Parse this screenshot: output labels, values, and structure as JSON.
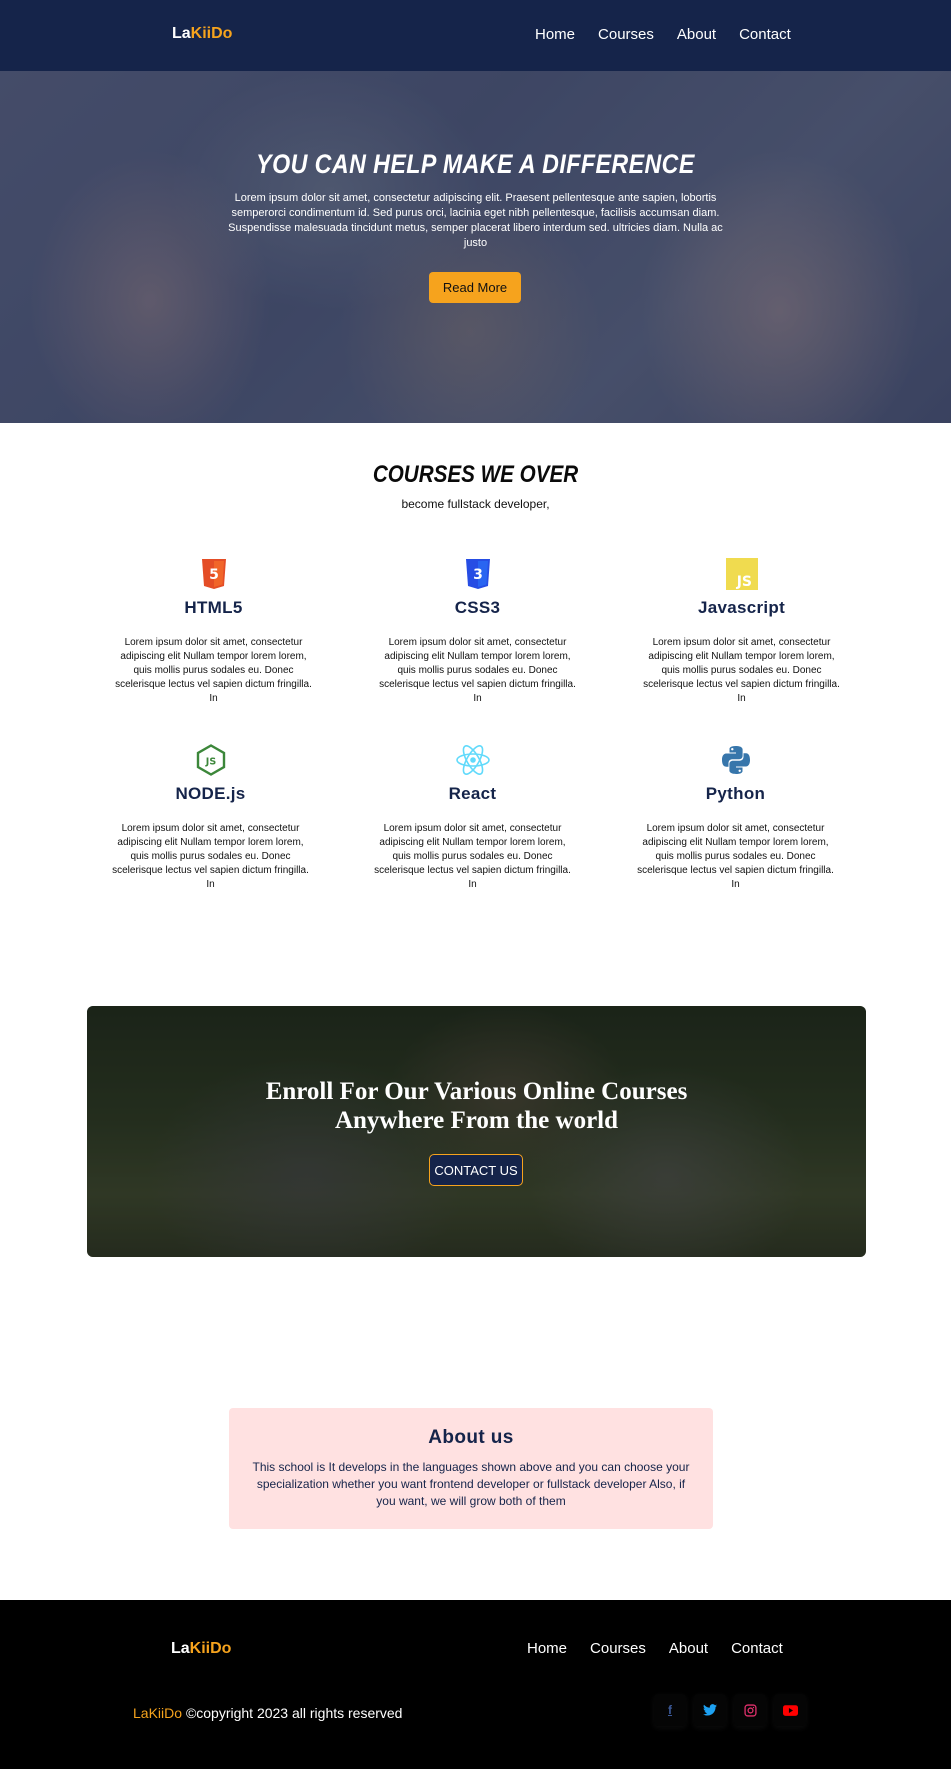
{
  "brand": {
    "part1": "La",
    "part2": "KiiDo"
  },
  "nav": {
    "items": [
      "Home",
      "Courses",
      "About",
      "Contact"
    ]
  },
  "hero": {
    "title": "YOU CAN HELP MAKE A DIFFERENCE",
    "text": "Lorem ipsum dolor sit amet, consectetur adipiscing elit. Praesent pellentesque ante sapien, lobortis semperorci condimentum id. Sed purus orci, lacinia eget nibh pellentesque, facilisis accumsan diam. Suspendisse malesuada tincidunt metus, semper placerat libero interdum sed. ultricies diam. Nulla ac justo",
    "button": "Read More"
  },
  "courses": {
    "title": "COURSES WE OVER",
    "subtitle": "become fullstack developer,",
    "items": [
      {
        "name": "HTML5",
        "icon": "html5-icon",
        "color": "#e44d26",
        "desc": "Lorem ipsum dolor sit amet, consectetur adipiscing elit Nullam tempor lorem lorem, quis mollis purus sodales eu. Donec scelerisque lectus vel sapien dictum fringilla. In"
      },
      {
        "name": "CSS3",
        "icon": "css3-icon",
        "color": "#264de4",
        "desc": "Lorem ipsum dolor sit amet, consectetur adipiscing elit Nullam tempor lorem lorem, quis mollis purus sodales eu. Donec scelerisque lectus vel sapien dictum fringilla. In"
      },
      {
        "name": "Javascript",
        "icon": "javascript-icon",
        "color": "#f0db4f",
        "desc": "Lorem ipsum dolor sit amet, consectetur adipiscing elit Nullam tempor lorem lorem, quis mollis purus sodales eu. Donec scelerisque lectus vel sapien dictum fringilla. In"
      },
      {
        "name": "NODE.js",
        "icon": "nodejs-icon",
        "color": "#3c873a",
        "desc": "Lorem ipsum dolor sit amet, consectetur adipiscing elit Nullam tempor lorem lorem, quis mollis purus sodales eu. Donec scelerisque lectus vel sapien dictum fringilla. In"
      },
      {
        "name": "React",
        "icon": "react-icon",
        "color": "#61dafb",
        "desc": "Lorem ipsum dolor sit amet, consectetur adipiscing elit Nullam tempor lorem lorem, quis mollis purus sodales eu. Donec scelerisque lectus vel sapien dictum fringilla. In"
      },
      {
        "name": "Python",
        "icon": "python-icon",
        "color": "#3776ab",
        "desc": "Lorem ipsum dolor sit amet, consectetur adipiscing elit Nullam tempor lorem lorem, quis mollis purus sodales eu. Donec scelerisque lectus vel sapien dictum fringilla. In"
      }
    ]
  },
  "enroll": {
    "line1": "Enroll For Our Various Online Courses",
    "line2": "Anywhere From the world",
    "button": "CONTACT US"
  },
  "about": {
    "title": "About us",
    "text": "This school is It develops in the languages shown above and you can choose your specialization whether you want frontend developer or fullstack developer Also, if you want, we will grow both of them"
  },
  "footer": {
    "copyright": "©copyright 2023 all rights reserved",
    "socials": [
      {
        "icon": "facebook-icon",
        "glyph": "f",
        "color": "#3b5998"
      },
      {
        "icon": "twitter-icon",
        "glyph": "t",
        "color": "#1da1f2"
      },
      {
        "icon": "instagram-icon",
        "glyph": "◎",
        "color": "#e1306c"
      },
      {
        "icon": "youtube-icon",
        "glyph": "▶",
        "color": "#ff0000"
      }
    ]
  },
  "colors": {
    "navy": "#15244a",
    "accent": "#f6a31d",
    "about_bg": "#ffe1e1",
    "footer_bg": "#000000"
  }
}
